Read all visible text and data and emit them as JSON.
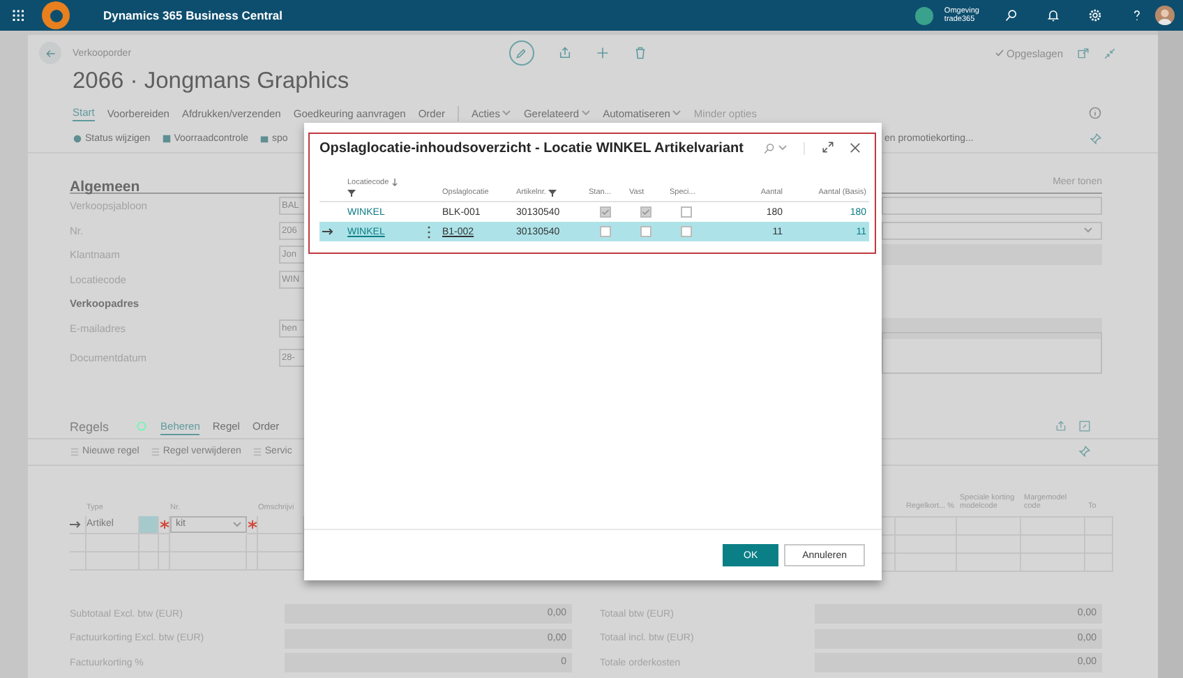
{
  "topbar": {
    "app_title": "Dynamics 365 Business Central",
    "environment_label": "Omgeving",
    "environment_name": "trade365"
  },
  "page": {
    "breadcrumb": "Verkooporder",
    "title": "2066 · Jongmans Graphics",
    "save_status": "Opgeslagen"
  },
  "action_tabs": [
    {
      "label": "Start",
      "selected": true
    },
    {
      "label": "Voorbereiden",
      "selected": false
    },
    {
      "label": "Afdrukken/verzenden",
      "selected": false
    },
    {
      "label": "Goedkeuring aanvragen",
      "selected": false
    },
    {
      "label": "Order",
      "selected": false
    }
  ],
  "action_menus": [
    "Acties",
    "Gerelateerd",
    "Automatiseren"
  ],
  "less_options": "Minder opties",
  "actions_left": [
    "Status wijzigen",
    "Voorraadcontrole",
    "spo"
  ],
  "actions_right": [
    "en promotiekorting..."
  ],
  "general": {
    "title": "Algemeen",
    "show_more": "Meer tonen",
    "fields": [
      {
        "label": "Verkoopsjabloon",
        "value": "BAL",
        "kind": "input"
      },
      {
        "label": "Nr.",
        "value": "206",
        "kind": "dropdown"
      },
      {
        "label": "Klantnaam",
        "value": "Jon",
        "kind": "readonly"
      },
      {
        "label": "Locatiecode",
        "value": "WIN",
        "kind": "plain"
      },
      {
        "label": "Verkoopadres",
        "kind": "heading"
      },
      {
        "label": "E-mailadres",
        "value": "hen",
        "kind": "readonly"
      },
      {
        "label": "Documentdatum",
        "value": "28-",
        "kind": "textarea"
      }
    ]
  },
  "lines": {
    "title": "Regels",
    "tabs": [
      {
        "label": "Beheren",
        "selected": true
      },
      {
        "label": "Regel",
        "selected": false
      },
      {
        "label": "Order",
        "selected": false
      }
    ],
    "actions": [
      {
        "label": "Nieuwe regel",
        "disabled": true
      },
      {
        "label": "Regel verwijderen",
        "disabled": true
      },
      {
        "label": "Servic",
        "disabled": true
      }
    ],
    "columns_left": [
      "Type",
      "Nr.",
      "Omschrijvi"
    ],
    "columns_right": [
      "Regelkort... %",
      "Speciale korting modelcode",
      "Margemodel code",
      "To"
    ],
    "rows": [
      {
        "type": "Artikel",
        "no": "kit",
        "selected": true
      }
    ]
  },
  "totals_left": [
    {
      "label": "Subtotaal Excl. btw (EUR)",
      "value": "0,00"
    },
    {
      "label": "Factuurkorting Excl. btw (EUR)",
      "value": "0,00"
    },
    {
      "label": "Factuurkorting %",
      "value": "0"
    }
  ],
  "totals_right": [
    {
      "label": "Totaal btw (EUR)",
      "value": "0,00"
    },
    {
      "label": "Totaal incl. btw (EUR)",
      "value": "0,00"
    },
    {
      "label": "Totale orderkosten",
      "value": "0,00"
    }
  ],
  "dialog": {
    "title": "Opslaglocatie-inhoudsoverzicht - Locatie WINKEL Artikelvariant",
    "columns": [
      {
        "label": "Locatiecode",
        "sorted": true,
        "filtered": true,
        "kind": "text"
      },
      {
        "label": "Opslaglocatie",
        "sorted": false,
        "filtered": false,
        "kind": "text"
      },
      {
        "label": "Artikelnr.",
        "sorted": false,
        "filtered": true,
        "kind": "text"
      },
      {
        "label": "Stan...",
        "sorted": false,
        "filtered": false,
        "kind": "check"
      },
      {
        "label": "Vast",
        "sorted": false,
        "filtered": false,
        "kind": "check"
      },
      {
        "label": "Speci...",
        "sorted": false,
        "filtered": false,
        "kind": "check"
      },
      {
        "label": "Aantal",
        "sorted": false,
        "filtered": false,
        "kind": "number"
      },
      {
        "label": "Aantal (Basis)",
        "sorted": false,
        "filtered": false,
        "kind": "number"
      }
    ],
    "rows": [
      {
        "location": "WINKEL",
        "bin": "BLK-001",
        "item": "30130540",
        "default": true,
        "fixed": true,
        "special": false,
        "quantity": "180",
        "quantity_base": "180",
        "selected": false
      },
      {
        "location": "WINKEL",
        "bin": "B1-002",
        "item": "30130540",
        "default": false,
        "fixed": false,
        "special": false,
        "quantity": "11",
        "quantity_base": "11",
        "selected": true
      }
    ],
    "buttons": [
      {
        "label": "OK",
        "kind": "primary"
      },
      {
        "label": "Annuleren",
        "kind": "secondary"
      }
    ]
  }
}
